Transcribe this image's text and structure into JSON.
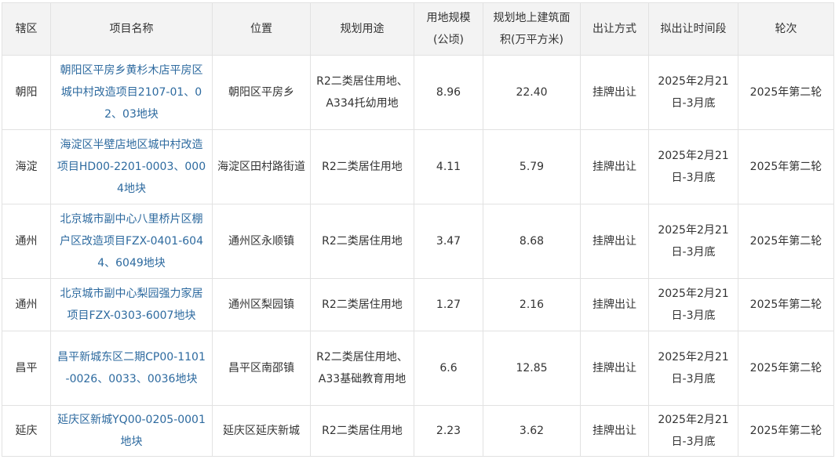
{
  "headers": [
    "辖区",
    "项目名称",
    "位置",
    "规划用途",
    "用地规模(公顷)",
    "规划地上建筑面积(万平方米)",
    "出让方式",
    "拟出让时间段",
    "轮次"
  ],
  "rows": [
    {
      "district": "朝阳",
      "name": "朝阳区平房乡黄杉木店平房区城中村改造项目2107-01、02、03地块",
      "location": "朝阳区平房乡",
      "use": "R2二类居住用地、A334托幼用地",
      "area": "8.96",
      "floor": "22.40",
      "method": "挂牌出让",
      "period": "2025年2月21日-3月底",
      "round": "2025年第二轮"
    },
    {
      "district": "海淀",
      "name": "海淀区半壁店地区城中村改造项目HD00-2201-0003、0004地块",
      "location": "海淀区田村路街道",
      "use": "R2二类居住用地",
      "area": "4.11",
      "floor": "5.79",
      "method": "挂牌出让",
      "period": "2025年2月21日-3月底",
      "round": "2025年第二轮"
    },
    {
      "district": "通州",
      "name": "北京城市副中心八里桥片区棚户区改造项目FZX-0401-6044、6049地块",
      "location": "通州区永顺镇",
      "use": "R2二类居住用地",
      "area": "3.47",
      "floor": "8.68",
      "method": "挂牌出让",
      "period": "2025年2月21日-3月底",
      "round": "2025年第二轮"
    },
    {
      "district": "通州",
      "name": "北京城市副中心梨园强力家居项目FZX-0303-6007地块",
      "location": "通州区梨园镇",
      "use": "R2二类居住用地",
      "area": "1.27",
      "floor": "2.16",
      "method": "挂牌出让",
      "period": "2025年2月21日-3月底",
      "round": "2025年第二轮"
    },
    {
      "district": "昌平",
      "name": "昌平新城东区二期CP00-1101-0026、0033、0036地块",
      "location": "昌平区南邵镇",
      "use": "R2二类居住用地、A33基础教育用地",
      "area": "6.6",
      "floor": "12.85",
      "method": "挂牌出让",
      "period": "2025年2月21日-3月底",
      "round": "2025年第二轮"
    },
    {
      "district": "延庆",
      "name": "延庆区新城YQ00-0205-0001地块",
      "location": "延庆区延庆新城",
      "use": "R2二类居住用地",
      "area": "2.23",
      "floor": "3.62",
      "method": "挂牌出让",
      "period": "2025年2月21日-3月底",
      "round": "2025年第二轮"
    }
  ],
  "colors": {
    "header_bg": "#f3f3f3",
    "border": "#e2e2e2",
    "link": "#2d6a9f",
    "text": "#333333"
  }
}
